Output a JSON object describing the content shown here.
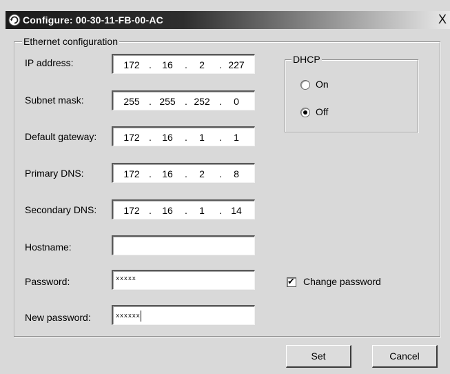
{
  "window": {
    "title": "Configure: 00-30-11-FB-00-AC",
    "close_symbol": "X",
    "icon": "refresh-icon"
  },
  "ethernet": {
    "legend": "Ethernet configuration",
    "fields": {
      "ip_address": {
        "label": "IP address:",
        "octets": [
          "172",
          "16",
          "2",
          "227"
        ]
      },
      "subnet_mask": {
        "label": "Subnet mask:",
        "octets": [
          "255",
          "255",
          "252",
          "0"
        ]
      },
      "default_gateway": {
        "label": "Default gateway:",
        "octets": [
          "172",
          "16",
          "1",
          "1"
        ]
      },
      "primary_dns": {
        "label": "Primary DNS:",
        "octets": [
          "172",
          "16",
          "2",
          "8"
        ]
      },
      "secondary_dns": {
        "label": "Secondary DNS:",
        "octets": [
          "172",
          "16",
          "1",
          "14"
        ]
      }
    },
    "hostname": {
      "label": "Hostname:",
      "value": ""
    },
    "password": {
      "label": "Password:",
      "value": "xxxxx"
    },
    "new_password": {
      "label": "New password:",
      "value": "xxxxxx"
    }
  },
  "dhcp": {
    "legend": "DHCP",
    "on_label": "On",
    "off_label": "Off",
    "selected": "Off"
  },
  "change_password": {
    "label": "Change password",
    "checked": true,
    "mark": "✔"
  },
  "buttons": {
    "set": "Set",
    "cancel": "Cancel"
  },
  "ip_separator": "."
}
